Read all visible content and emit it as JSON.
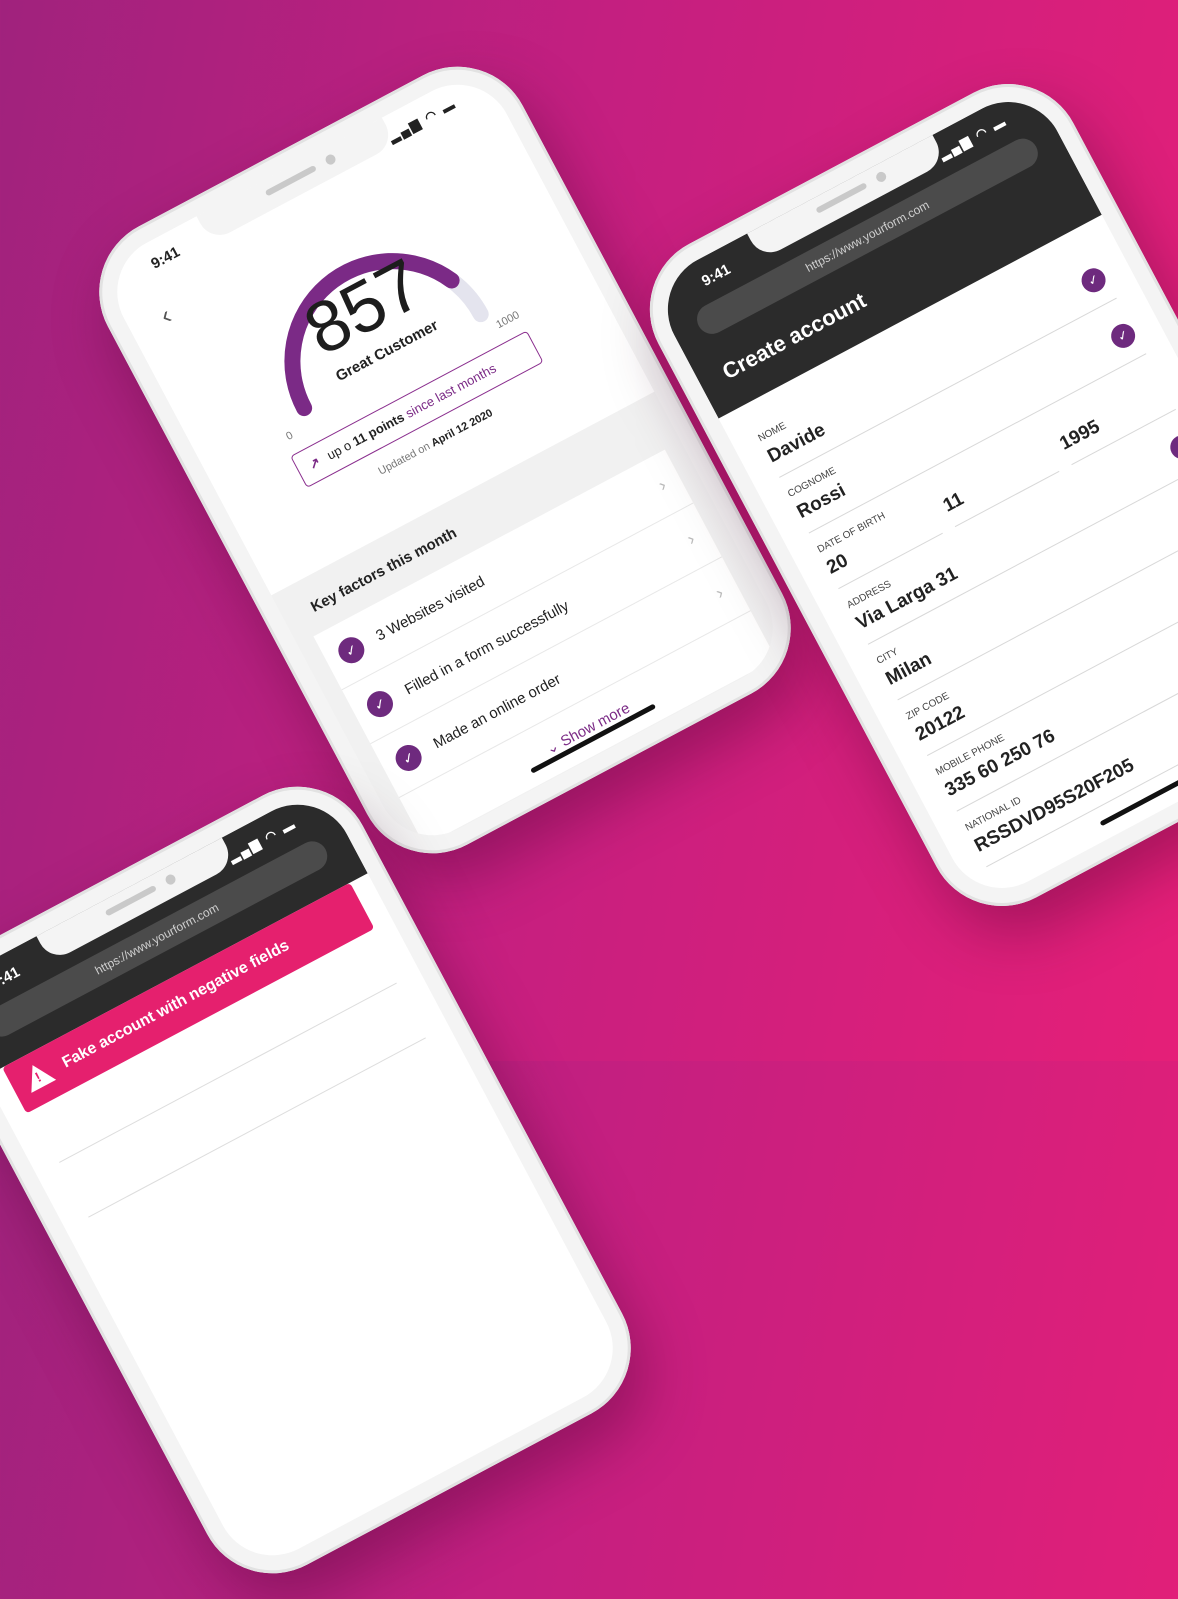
{
  "status": {
    "time": "9:41",
    "icons": "signal wifi battery"
  },
  "score_app": {
    "score": "857",
    "label": "Great Customer",
    "min": "0",
    "max": "1000",
    "gauge_fraction": 0.857,
    "trend_prefix": "up o",
    "trend_points": "11 points",
    "trend_suffix": "since last months",
    "updated_prefix": "Updated on",
    "updated_date": "April 12 2020",
    "factors_title": "Key factors this month",
    "factors": [
      "3 Websites visited",
      "Filled in a form successfully",
      "Made an online order"
    ],
    "show_more": "Show more"
  },
  "form_app": {
    "url": "https://www.yourform.com",
    "title": "Create account",
    "fields": {
      "nome": {
        "label": "Nome",
        "value": "Davide"
      },
      "cognome": {
        "label": "Cognome",
        "value": "Rossi"
      },
      "dob_label": "DATE OF BIRTH",
      "dob_day": "20",
      "dob_month": "11",
      "dob_year": "1995",
      "address": {
        "label": "Address",
        "value": "Via Larga 31"
      },
      "city": {
        "label": "City",
        "value": "Milan"
      },
      "zip": {
        "label": "Zip code",
        "value": "20122"
      },
      "phone": {
        "label": "Mobile phone",
        "value": "335 60 250 76"
      },
      "national_id": {
        "label": "National ID",
        "value": "RSSDVD95S20F205"
      }
    }
  },
  "fake_app": {
    "url": "https://www.yourform.com",
    "alert": "Fake account with negative fields",
    "alert_icon": "!"
  },
  "colors": {
    "accent": "#6e2a7e",
    "alert": "#e5206e",
    "bg_start": "#a0227d",
    "bg_end": "#e51f78"
  }
}
